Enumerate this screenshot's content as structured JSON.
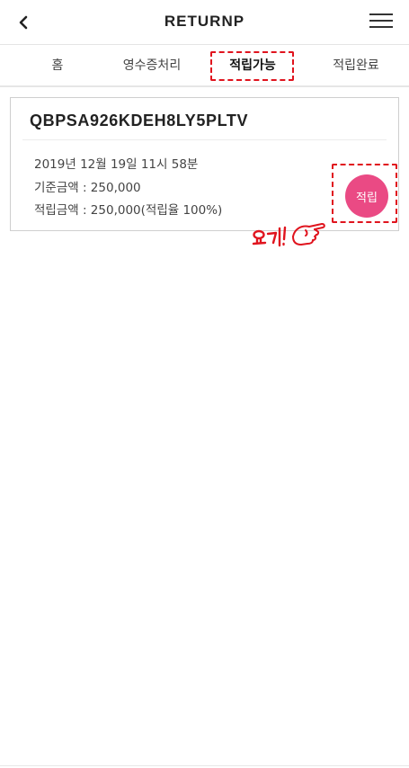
{
  "header": {
    "title": "RETURNP",
    "back_icon": "chevron-left-icon",
    "menu_icon": "hamburger-menu-icon"
  },
  "tabs": [
    {
      "label": "홈",
      "active": false
    },
    {
      "label": "영수증처리",
      "active": false
    },
    {
      "label": "적립가능",
      "active": true
    },
    {
      "label": "적립완료",
      "active": false
    }
  ],
  "card": {
    "code": "QBPSA926KDEH8LY5PLTV",
    "datetime": "2019년 12월 19일 11시 58분",
    "base_amount": "기준금액 : 250,000",
    "earn_amount": "적립금액 : 250,000(적립율 100%)",
    "earn_button": "적립"
  },
  "annotation": {
    "text": "요기!",
    "icon": "pointing-hand-icon",
    "color": "#e0141e"
  },
  "colors": {
    "accent_button": "#ea4a84",
    "highlight": "#e0141e"
  }
}
